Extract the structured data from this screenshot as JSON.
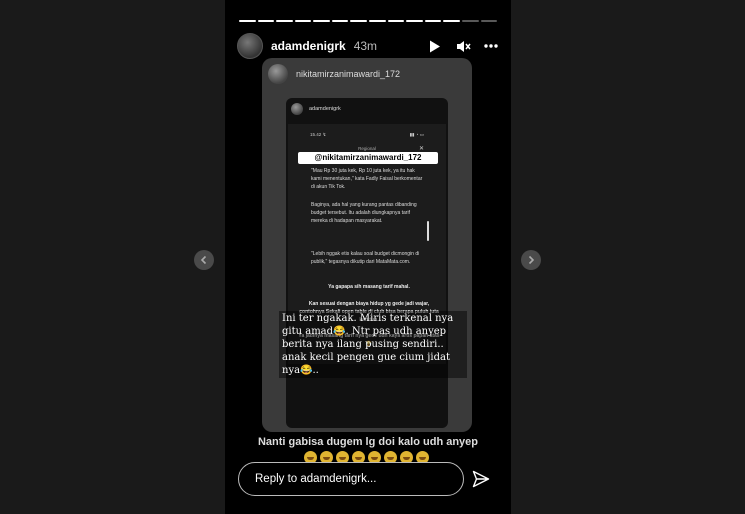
{
  "progress": {
    "total_segments": 14,
    "active_segments": 12
  },
  "header": {
    "username": "adamdenigrk",
    "time": "43m"
  },
  "reshare": {
    "username": "nikitamirzanimawardi_172",
    "inner_username": "adamdenigrk",
    "phone": {
      "status_time": "15.42 ↯",
      "status_icons": "▮▮ ◔ ▭",
      "regional": "Regional",
      "close": "✕",
      "mention": "@nikitamirzanimawardi_172",
      "paragraphs": [
        "\"Mau Rp 30 juta kek, Rp 10 juta kek, ya itu hak kami menentukan,\" kata Fadly Faisal berkomentar di akun Tik Tok.",
        "Baginya, ada hal yang kurang pantas dibanding budget tersebut. Itu adalah diungkapnya tarif mereka di hadapan masyarakat.",
        "\"Lebih nggak etis kalau soal budget dicmongin di publik,\" tegasnya dikutip dari MataMata.com."
      ],
      "bold_lines": [
        "Ya gapapa sih masang tarif mahal.",
        "Kan sesuai dengan biaya hidup yg gede jadi wajar, contohnya Sekali open table di club bisa berapa puluh juta kan tuh.",
        "Ya jadinya masang tarif nya gede udh kaya artis papan atas 😂"
      ]
    },
    "overlay_text": "Ini ter ngakak. Miris terkenal nya gitu amad😂. Ntr pas udh anyep berita nya ilang pusing sendiri.. anak kecil pengen gue cium jidat nya😂.."
  },
  "caption": "Nanti gabisa dugem lg doi kalo udh anyep",
  "caption_emoji_count": 8,
  "reply": {
    "placeholder": "Reply to adamdenigrk..."
  },
  "icons": {
    "play": "play-icon",
    "mute": "speaker-muted-icon",
    "more": "more-icon",
    "send": "send-icon",
    "prev": "chevron-left-icon",
    "next": "chevron-right-icon"
  },
  "colors": {
    "background": "#1a1a1a",
    "story": "#000000",
    "reshare_card": "#3a3a3a"
  }
}
